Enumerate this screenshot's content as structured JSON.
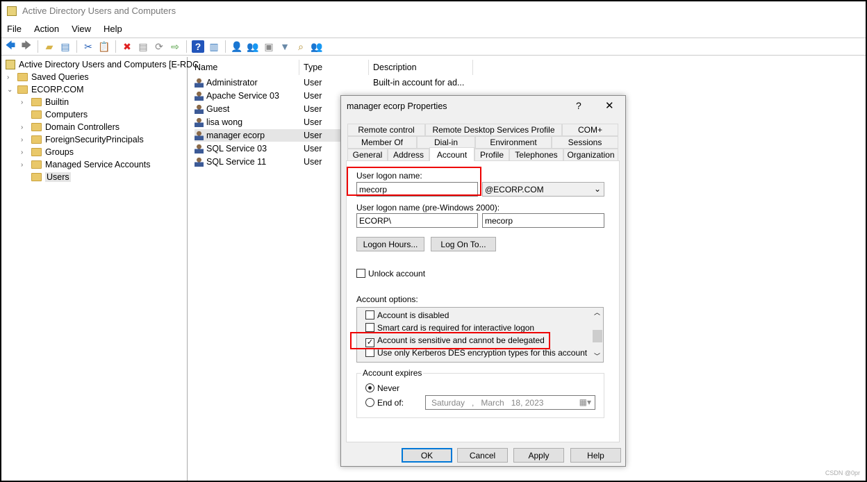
{
  "window": {
    "title": "Active Directory Users and Computers"
  },
  "menu": [
    "File",
    "Action",
    "View",
    "Help"
  ],
  "toolbar": [
    "back-icon",
    "forward-icon",
    "up-folder-icon",
    "show-hide-tree-icon",
    "cut-icon",
    "paste-icon",
    "delete-icon",
    "properties-icon",
    "refresh-icon",
    "export-list-icon",
    "help-icon",
    "action-pane-icon",
    "new-user-icon",
    "new-group-icon",
    "new-ou-icon",
    "filter-icon",
    "find-icon",
    "add-to-group-icon"
  ],
  "tree": {
    "root": "Active Directory Users and Computers [E-RDC",
    "items": [
      {
        "label": "Saved Queries",
        "level": 1,
        "expander": ">"
      },
      {
        "label": "ECORP.COM",
        "level": 1,
        "expander": "v"
      },
      {
        "label": "Builtin",
        "level": 2,
        "expander": ">"
      },
      {
        "label": "Computers",
        "level": 2,
        "expander": ""
      },
      {
        "label": "Domain Controllers",
        "level": 2,
        "expander": ">"
      },
      {
        "label": "ForeignSecurityPrincipals",
        "level": 2,
        "expander": ">"
      },
      {
        "label": "Groups",
        "level": 2,
        "expander": ">"
      },
      {
        "label": "Managed Service Accounts",
        "level": 2,
        "expander": ">"
      },
      {
        "label": "Users",
        "level": 2,
        "expander": "",
        "selected": true
      }
    ]
  },
  "list": {
    "columns": [
      "Name",
      "Type",
      "Description"
    ],
    "rows": [
      {
        "name": "Administrator",
        "type": "User",
        "description": "Built-in account for ad..."
      },
      {
        "name": "Apache Service 03",
        "type": "User",
        "description": ""
      },
      {
        "name": "Guest",
        "type": "User",
        "description": ""
      },
      {
        "name": "lisa wong",
        "type": "User",
        "description": ""
      },
      {
        "name": "manager ecorp",
        "type": "User",
        "description": "",
        "selected": true
      },
      {
        "name": "SQL Service 03",
        "type": "User",
        "description": ""
      },
      {
        "name": "SQL Service 11",
        "type": "User",
        "description": ""
      }
    ]
  },
  "dialog": {
    "title": "manager ecorp Properties",
    "help": "?",
    "close": "✕",
    "tabs_row1": [
      "Remote control",
      "Remote Desktop Services Profile",
      "COM+"
    ],
    "tabs_row2": [
      "Member Of",
      "Dial-in",
      "Environment",
      "Sessions"
    ],
    "tabs_row3": [
      "General",
      "Address",
      "Account",
      "Profile",
      "Telephones",
      "Organization"
    ],
    "active_tab": "Account",
    "logon_name_label": "User logon name:",
    "logon_name": "mecorp",
    "domain": "@ECORP.COM",
    "pre2000_label": "User logon name (pre-Windows 2000):",
    "pre2000_domain": "ECORP\\",
    "pre2000_name": "mecorp",
    "logon_hours": "Logon Hours...",
    "log_on_to": "Log On To...",
    "unlock": "Unlock account",
    "options_label": "Account options:",
    "options": [
      {
        "label": "Account is disabled",
        "checked": false
      },
      {
        "label": "Smart card is required for interactive logon",
        "checked": false
      },
      {
        "label": "Account is sensitive and cannot be delegated",
        "checked": true
      },
      {
        "label": "Use only Kerberos DES encryption types for this account",
        "checked": false
      }
    ],
    "expires_label": "Account expires",
    "never": "Never",
    "end_of": "End of:",
    "expires_selected": "Never",
    "date": {
      "day": "Saturday",
      "sep": ",",
      "month": "March",
      "rest": "18, 2023"
    },
    "buttons": [
      "OK",
      "Cancel",
      "Apply",
      "Help"
    ]
  },
  "watermark": "CSDN @0pr",
  "colors": {
    "highlight": "#e00000",
    "selection": "#e5e5e5",
    "dialog_bg": "#f0f0f0"
  }
}
